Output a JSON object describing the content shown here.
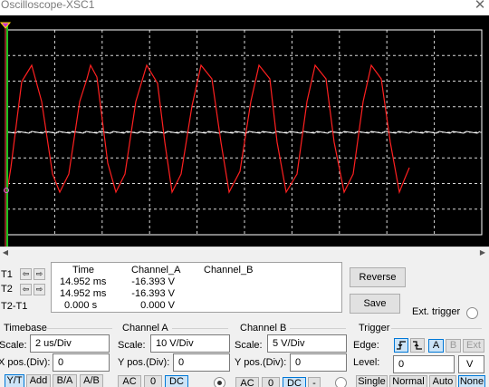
{
  "window": {
    "title": "Oscilloscope-XSC1",
    "close_glyph": "✕"
  },
  "screen": {
    "background": "#000000",
    "grid_color": "#ffffff",
    "trace_a_color": "#ff2020",
    "trace_b_color": "#ffffff",
    "cursor1_color": "#ff4040",
    "cursor2_color": "#20c020"
  },
  "cursors": {
    "t1_label": "T1",
    "t2_label": "T2",
    "diff_label": "T2-T1",
    "arrow_left": "⇦",
    "arrow_right": "⇨"
  },
  "readout": {
    "headers": {
      "time": "Time",
      "channel_a": "Channel_A",
      "channel_b": "Channel_B"
    },
    "rows": [
      {
        "time": "14.952 ms",
        "channel_a": "-16.393 V",
        "channel_b": ""
      },
      {
        "time": "14.952 ms",
        "channel_a": "-16.393 V",
        "channel_b": ""
      },
      {
        "time": "0.000 s",
        "channel_a": "0.000 V",
        "channel_b": ""
      }
    ]
  },
  "buttons": {
    "reverse": "Reverse",
    "save": "Save",
    "ext_trigger": "Ext. trigger"
  },
  "timebase": {
    "title": "Timebase",
    "scale_label": "Scale:",
    "scale_value": "2 us/Div",
    "xpos_label": "X pos.(Div):",
    "xpos_value": "0",
    "modes": [
      "Y/T",
      "Add",
      "B/A",
      "A/B"
    ],
    "selected_mode": "Y/T"
  },
  "channel_a": {
    "title": "Channel A",
    "scale_label": "Scale:",
    "scale_value": "10  V/Div",
    "ypos_label": "Y pos.(Div):",
    "ypos_value": "0",
    "coupling": [
      "AC",
      "0",
      "DC"
    ],
    "selected_coupling": "DC"
  },
  "channel_b": {
    "title": "Channel B",
    "scale_label": "Scale:",
    "scale_value": "5  V/Div",
    "ypos_label": "Y pos.(Div):",
    "ypos_value": "0",
    "coupling": [
      "AC",
      "0",
      "DC",
      "-"
    ],
    "selected_coupling": "DC"
  },
  "trigger": {
    "title": "Trigger",
    "edge_label": "Edge:",
    "edge_rising_icon": "rising-edge-icon",
    "edge_falling_icon": "falling-edge-icon",
    "sources": [
      "A",
      "B",
      "Ext"
    ],
    "selected_source": "A",
    "level_label": "Level:",
    "level_value": "0",
    "level_unit": "V",
    "modes": [
      "Single",
      "Normal",
      "Auto",
      "None"
    ],
    "selected_mode": "None"
  }
}
